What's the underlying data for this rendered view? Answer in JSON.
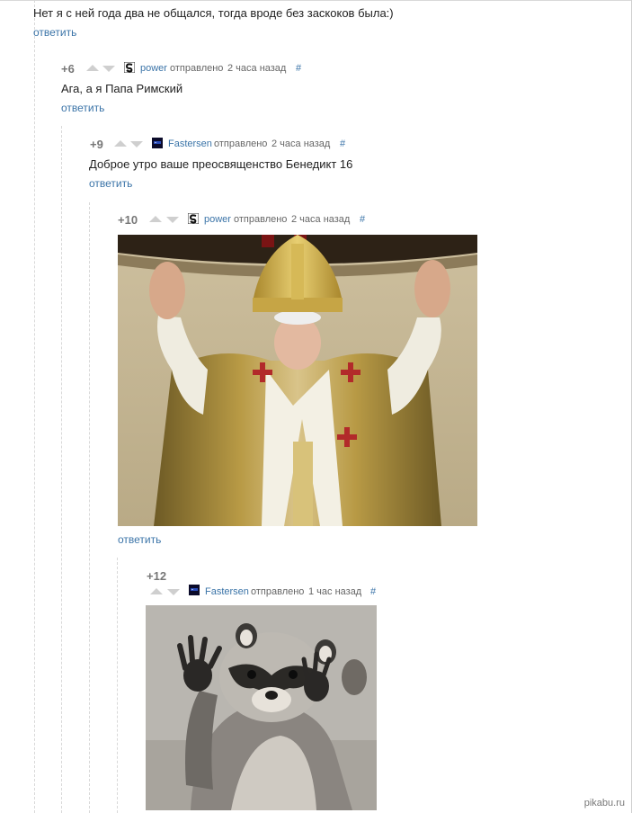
{
  "root_comment": {
    "text": "Нет я с ней года два не общался, тогда вроде без заскоков была:)",
    "reply_label": "ответить"
  },
  "comments": [
    {
      "rating": "+6",
      "author": "power",
      "sent_label": "отправлено",
      "time": "2 часа назад",
      "hash": "#",
      "text": "Ага, а я Папа Римский",
      "reply_label": "ответить"
    },
    {
      "rating": "+9",
      "author": "Fastersen",
      "sent_label": "отправлено",
      "time": "2 часа назад",
      "hash": "#",
      "text": "Доброе утро ваше преосвященство Бенедикт 16",
      "reply_label": "ответить"
    },
    {
      "rating": "+10",
      "author": "power",
      "sent_label": "отправлено",
      "time": "2 часа назад",
      "hash": "#",
      "image": "pope-waving-photo",
      "reply_label": "ответить"
    },
    {
      "rating": "+12",
      "author": "Fastersen",
      "sent_label": "отправлено",
      "time": "1 час назад",
      "hash": "#",
      "image": "raccoon-waving-photo"
    }
  ],
  "watermark": "pikabu.ru",
  "colors": {
    "link": "#3b74a8",
    "rating": "#777777",
    "vote_arrow": "#cfcfcf"
  }
}
